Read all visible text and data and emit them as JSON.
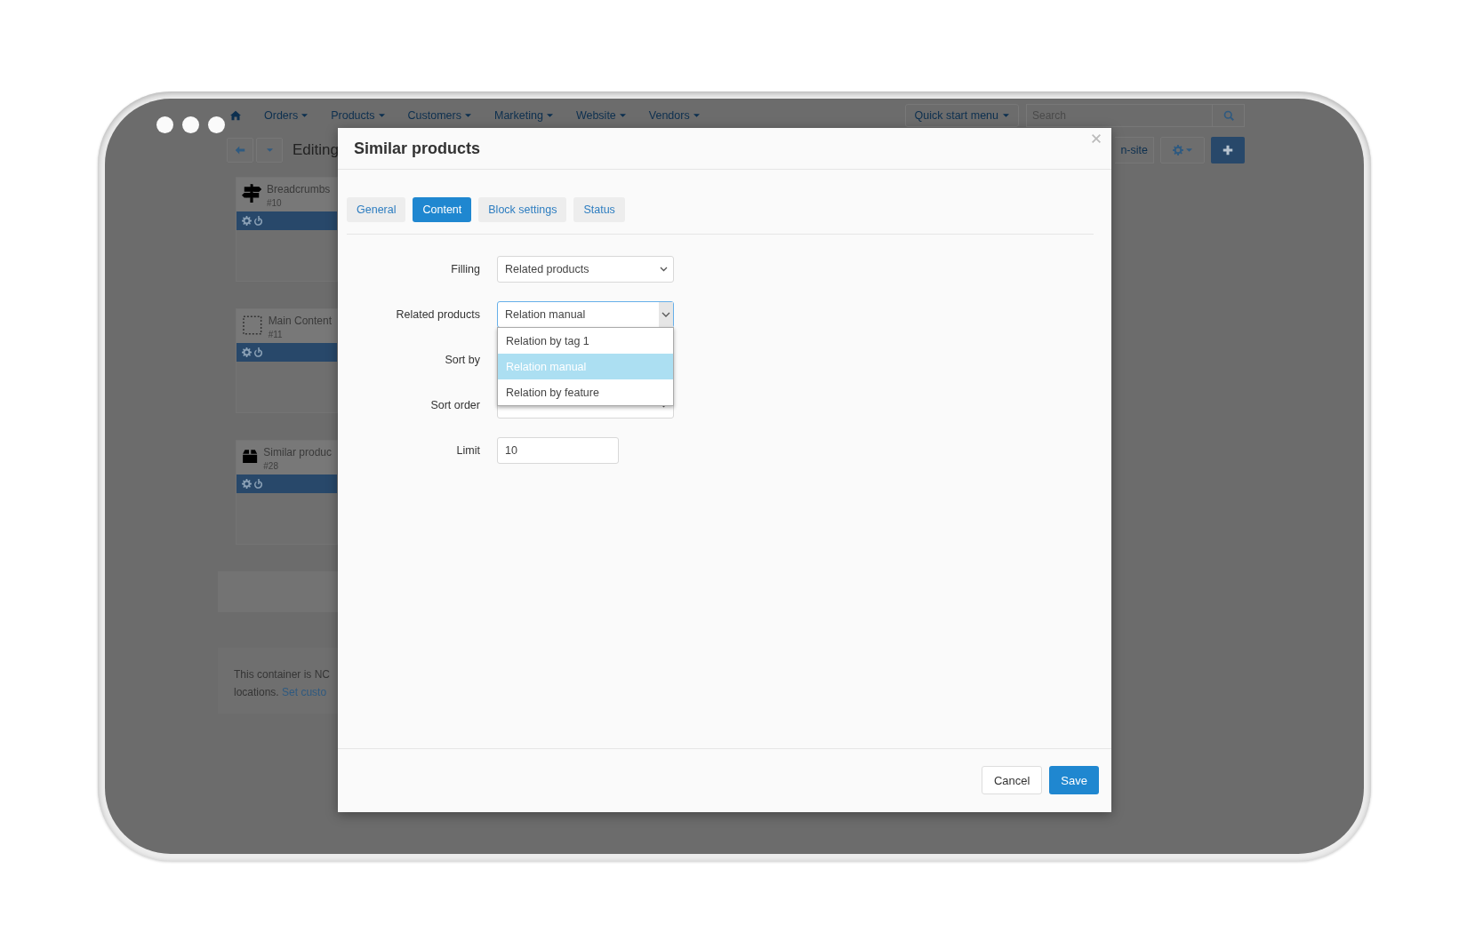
{
  "nav": {
    "items": [
      "Orders",
      "Products",
      "Customers",
      "Marketing",
      "Website",
      "Vendors"
    ],
    "quick_start": "Quick start menu",
    "search": {
      "placeholder": "Search"
    }
  },
  "toolbar": {
    "title": "Editing",
    "right_button": "n-site"
  },
  "blocks": [
    {
      "kind": "signpost",
      "name": "Breadcrumbs",
      "id": "#10"
    },
    {
      "kind": "placeholder",
      "name": "Main Content",
      "id": "#11"
    },
    {
      "kind": "box",
      "name": "Similar produc",
      "id": "#28"
    }
  ],
  "notice": {
    "line1": "This container is NC",
    "line2": "locations.",
    "link": "Set custo"
  },
  "modal": {
    "title": "Similar products",
    "tabs": [
      {
        "label": "General",
        "selected": false
      },
      {
        "label": "Content",
        "selected": true
      },
      {
        "label": "Block settings",
        "selected": false
      },
      {
        "label": "Status",
        "selected": false
      }
    ],
    "fields": [
      {
        "kind": "select",
        "label": "Filling",
        "value": "Related products"
      },
      {
        "kind": "select",
        "label": "Related products",
        "value": "Relation manual",
        "expanded": true,
        "options": [
          {
            "label": "Relation by tag 1",
            "selected": false
          },
          {
            "label": "Relation manual",
            "selected": true
          },
          {
            "label": "Relation by feature",
            "selected": false
          }
        ]
      },
      {
        "label": "Sort by"
      },
      {
        "kind": "select",
        "label": "Sort order"
      },
      {
        "kind": "text",
        "label": "Limit",
        "value": "10"
      }
    ],
    "buttons": {
      "cancel": "Cancel",
      "save": "Save"
    }
  }
}
